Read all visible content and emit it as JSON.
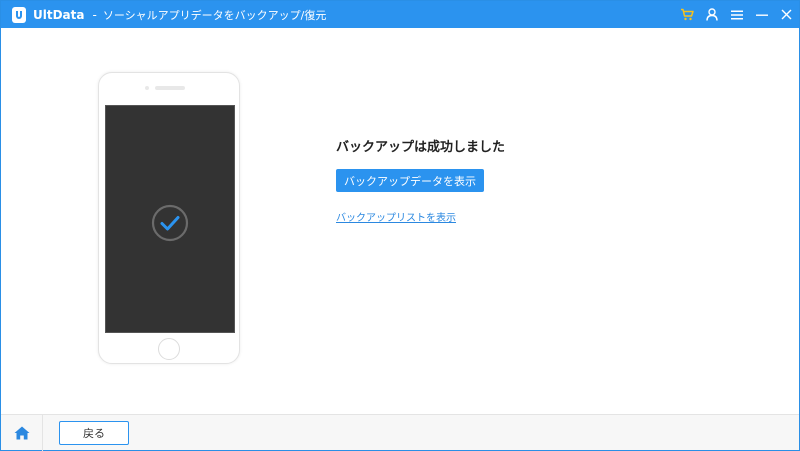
{
  "app": {
    "name": "UltData",
    "separator": "-",
    "subtitle": "ソーシャルアプリデータをバックアップ/復元"
  },
  "title_controls": {
    "icons": [
      "cart-icon",
      "user-icon",
      "menu-icon",
      "minimize-icon",
      "close-icon"
    ],
    "cart_color": "#f7c21c"
  },
  "main": {
    "result_title": "バックアップは成功しました",
    "view_data_button": "バックアップデータを表示",
    "backup_list_link": "バックアップリストを表示"
  },
  "bottom": {
    "back_button": "戻る"
  },
  "colors": {
    "accent": "#2b93ef",
    "screen": "#333333",
    "check": "#2b93ef"
  }
}
